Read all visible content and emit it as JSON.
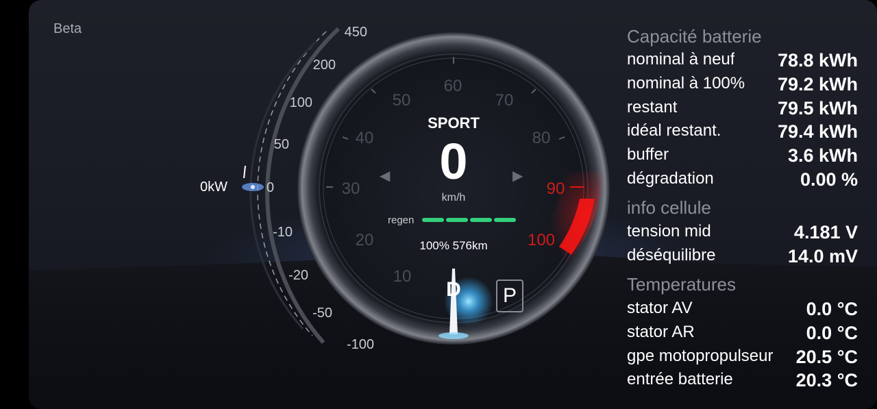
{
  "app": {
    "beta_label": "Beta"
  },
  "power_gauge": {
    "current_label": "0kW",
    "value_kw": 0,
    "scale": [
      "450",
      "200",
      "100",
      "50",
      "0",
      "-10",
      "-20",
      "-50",
      "-100"
    ]
  },
  "speedometer": {
    "mode": "SPORT",
    "speed": "0",
    "unit": "km/h",
    "scale": [
      "10",
      "20",
      "30",
      "40",
      "50",
      "60",
      "70",
      "80",
      "90",
      "100"
    ],
    "regen_label": "regen",
    "regen_segments_active": 4,
    "battery_range": "100% 576km",
    "gear_current": "D",
    "gear_park": "P"
  },
  "colors": {
    "accent_red": "#d11a1a",
    "regen_green": "#34d07c",
    "glow_blue": "#3fb6ff"
  },
  "icons": {
    "left": "turn-left-arrow-icon",
    "right": "turn-right-arrow-icon"
  },
  "battery": {
    "title": "Capacité batterie",
    "rows": [
      {
        "label": "nominal à neuf",
        "value": "78.8 kWh"
      },
      {
        "label": "nominal à 100%",
        "value": "79.2 kWh"
      },
      {
        "label": "restant",
        "value": "79.5 kWh"
      },
      {
        "label": "idéal restant.",
        "value": "79.4 kWh"
      },
      {
        "label": "buffer",
        "value": "3.6 kWh"
      },
      {
        "label": "dégradation",
        "value": "0.00 %"
      }
    ]
  },
  "cell": {
    "title": "info cellule",
    "rows": [
      {
        "label": "tension mid",
        "value": "4.181 V"
      },
      {
        "label": "déséquilibre",
        "value": "14.0 mV"
      }
    ]
  },
  "temps": {
    "title": "Temperatures",
    "rows": [
      {
        "label": "stator AV",
        "value": "0.0 °C"
      },
      {
        "label": "stator AR",
        "value": "0.0 °C"
      },
      {
        "label": "gpe motopropulseur",
        "value": "20.5 °C"
      },
      {
        "label": "entrée batterie",
        "value": "20.3 °C"
      }
    ]
  }
}
